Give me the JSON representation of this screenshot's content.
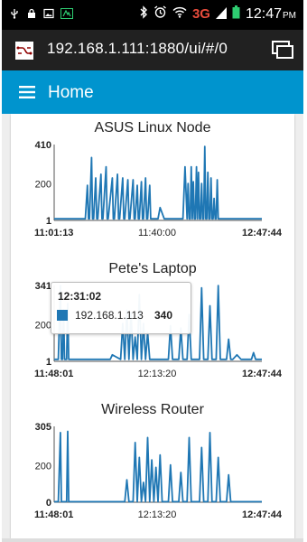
{
  "status_bar": {
    "icons": [
      "usb-icon",
      "lock-icon",
      "image-icon",
      "app-icon"
    ],
    "right_icons": [
      "bluetooth-icon",
      "alarm-icon",
      "wifi-icon",
      "signal-icon",
      "battery-icon"
    ],
    "network": "3G",
    "time": "12:47",
    "ampm": "PM"
  },
  "browser": {
    "url": "192.168.1.111:1880/ui/#/0",
    "icons": [
      "node-red-icon",
      "tabs-icon"
    ]
  },
  "header": {
    "title": "Home",
    "menu_icon": "hamburger-icon"
  },
  "colors": {
    "header": "#0094ce",
    "series": "#1f77b4",
    "url_bar": "#212121"
  },
  "tooltip": {
    "time": "12:31:02",
    "series": "192.168.1.113",
    "value": "340"
  },
  "chart_data": [
    {
      "type": "line",
      "title": "ASUS Linux Node",
      "ylim": [
        1,
        410
      ],
      "yticks": [
        "410",
        "200",
        "1"
      ],
      "xticks": [
        "11:01:13",
        "11:40:00",
        "12:47:44"
      ],
      "series": [
        {
          "x": [
            0.0,
            0.05,
            0.1,
            0.15,
            0.16,
            0.165,
            0.17,
            0.18,
            0.185,
            0.19,
            0.2,
            0.205,
            0.21,
            0.225,
            0.23,
            0.235,
            0.25,
            0.255,
            0.26,
            0.28,
            0.285,
            0.29,
            0.305,
            0.31,
            0.315,
            0.33,
            0.335,
            0.34,
            0.355,
            0.36,
            0.365,
            0.38,
            0.385,
            0.39,
            0.4,
            0.405,
            0.41,
            0.42,
            0.425,
            0.43,
            0.44,
            0.445,
            0.45,
            0.46,
            0.465,
            0.47,
            0.5,
            0.51,
            0.53,
            0.54,
            0.57,
            0.6,
            0.62,
            0.63,
            0.64,
            0.645,
            0.65,
            0.655,
            0.66,
            0.665,
            0.67,
            0.675,
            0.68,
            0.685,
            0.69,
            0.695,
            0.7,
            0.705,
            0.71,
            0.715,
            0.72,
            0.725,
            0.73,
            0.735,
            0.74,
            0.745,
            0.75,
            0.755,
            0.76,
            0.765,
            0.77,
            0.775,
            0.78,
            0.785,
            0.79,
            0.8,
            0.81,
            0.85,
            0.9,
            0.95,
            1.0
          ],
          "y": [
            10,
            10,
            10,
            10,
            190,
            10,
            10,
            340,
            10,
            10,
            230,
            10,
            10,
            250,
            10,
            10,
            290,
            10,
            10,
            230,
            10,
            10,
            250,
            10,
            10,
            230,
            10,
            10,
            220,
            10,
            10,
            220,
            10,
            10,
            190,
            10,
            10,
            210,
            10,
            10,
            230,
            10,
            10,
            190,
            10,
            10,
            10,
            70,
            10,
            10,
            10,
            10,
            10,
            290,
            10,
            200,
            10,
            10,
            290,
            10,
            210,
            10,
            10,
            290,
            10,
            260,
            10,
            10,
            200,
            10,
            10,
            400,
            10,
            10,
            260,
            10,
            10,
            230,
            10,
            10,
            120,
            10,
            10,
            220,
            10,
            10,
            10,
            10,
            10,
            10,
            10
          ]
        }
      ]
    },
    {
      "type": "line",
      "title": "Pete's Laptop",
      "ylim": [
        1,
        341
      ],
      "yticks": [
        "341",
        "200",
        "1"
      ],
      "xticks": [
        "11:48:01",
        "12:13:20",
        "12:47:44"
      ],
      "series": [
        {
          "x": [
            0.0,
            0.02,
            0.03,
            0.035,
            0.04,
            0.045,
            0.05,
            0.06,
            0.065,
            0.07,
            0.08,
            0.1,
            0.2,
            0.27,
            0.28,
            0.32,
            0.33,
            0.34,
            0.35,
            0.36,
            0.37,
            0.38,
            0.39,
            0.4,
            0.41,
            0.42,
            0.43,
            0.44,
            0.45,
            0.46,
            0.47,
            0.5,
            0.55,
            0.56,
            0.57,
            0.6,
            0.61,
            0.62,
            0.64,
            0.65,
            0.66,
            0.7,
            0.71,
            0.72,
            0.74,
            0.75,
            0.76,
            0.78,
            0.79,
            0.8,
            0.83,
            0.84,
            0.85,
            0.86,
            0.88,
            0.9,
            0.92,
            0.95,
            0.96,
            0.97,
            1.0
          ],
          "y": [
            10,
            10,
            340,
            10,
            10,
            230,
            10,
            10,
            260,
            10,
            10,
            10,
            10,
            10,
            30,
            10,
            170,
            10,
            230,
            10,
            220,
            10,
            110,
            10,
            300,
            10,
            170,
            10,
            130,
            10,
            10,
            10,
            10,
            160,
            10,
            10,
            150,
            10,
            10,
            210,
            10,
            10,
            330,
            10,
            10,
            250,
            10,
            10,
            340,
            10,
            10,
            100,
            10,
            10,
            30,
            10,
            10,
            10,
            40,
            10,
            10
          ]
        }
      ]
    },
    {
      "type": "line",
      "title": "Wireless Router",
      "ylim": [
        0,
        305
      ],
      "yticks": [
        "305",
        "200",
        "0"
      ],
      "xticks": [
        "11:48:01",
        "12:13:20",
        "12:47:44"
      ],
      "series": [
        {
          "x": [
            0.0,
            0.02,
            0.03,
            0.035,
            0.04,
            0.045,
            0.05,
            0.06,
            0.065,
            0.07,
            0.08,
            0.1,
            0.2,
            0.3,
            0.34,
            0.35,
            0.36,
            0.38,
            0.39,
            0.4,
            0.41,
            0.42,
            0.43,
            0.44,
            0.45,
            0.46,
            0.47,
            0.48,
            0.49,
            0.5,
            0.51,
            0.52,
            0.55,
            0.56,
            0.57,
            0.6,
            0.61,
            0.62,
            0.64,
            0.65,
            0.66,
            0.7,
            0.71,
            0.72,
            0.74,
            0.75,
            0.76,
            0.78,
            0.79,
            0.8,
            0.83,
            0.84,
            0.85,
            0.9,
            0.95,
            1.0
          ],
          "y": [
            2,
            2,
            280,
            2,
            2,
            2,
            2,
            2,
            285,
            2,
            2,
            2,
            2,
            2,
            2,
            90,
            2,
            2,
            240,
            2,
            180,
            2,
            80,
            2,
            260,
            2,
            170,
            2,
            140,
            2,
            190,
            2,
            2,
            150,
            2,
            2,
            120,
            2,
            2,
            260,
            2,
            2,
            220,
            2,
            2,
            280,
            2,
            2,
            180,
            2,
            2,
            110,
            2,
            2,
            2,
            2
          ]
        }
      ]
    }
  ]
}
